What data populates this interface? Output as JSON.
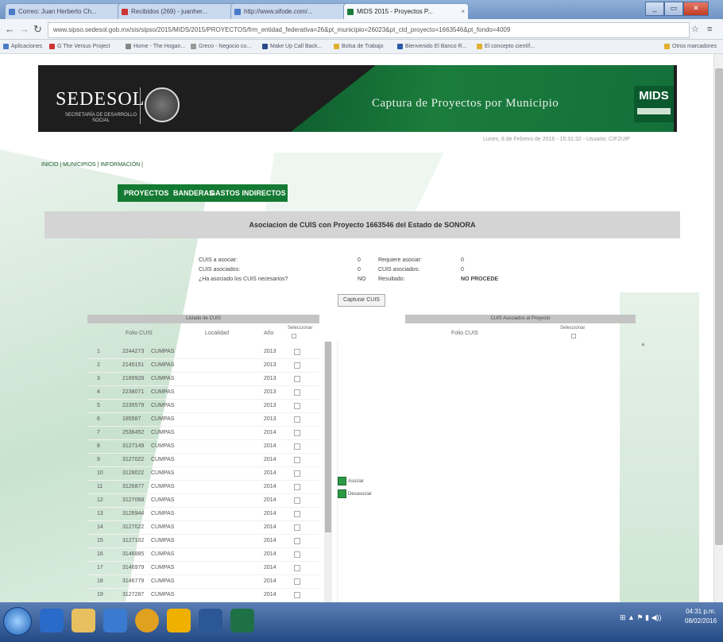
{
  "browser": {
    "tabs": [
      {
        "label": "Correo: Juan Herberto Ch...",
        "active": false
      },
      {
        "label": "Recibidos (269) - juanher...",
        "active": false
      },
      {
        "label": "http://www.sifode.com/...",
        "active": false
      },
      {
        "label": "MIDS 2015 - Proyectos P...",
        "active": true
      }
    ],
    "url": "www.sipso.sedesol.gob.mx/sis/sipso/2015/MIDS/2015/PROYECTOS/frm_entidad_federativa=26&pt_municipio=26023&pt_ctd_proyecto=1663546&pt_fondo=4009",
    "bookmarks": [
      "Aplicaciones",
      "G The Versus Project",
      "Home - The Hogan...",
      "Greco - Negocio co...",
      "Make Up Call Back...",
      "Bolsa de Trabajo",
      "Bienvenido El Banco R...",
      "El concepto científ...",
      "Otros marcadores"
    ],
    "window_buttons": [
      "minimize",
      "maximize",
      "close"
    ]
  },
  "header": {
    "brand": "SEDESOL",
    "brand_sub": "SECRETARÍA DE DESARROLLO SOCIAL",
    "title": "Captura de Proyectos por Municipio",
    "badge": "MIDS",
    "date_user": "Lunes, 8 de Febrero de 2016 - 15:31:32 - Usuario: CIF2UIP"
  },
  "breadcrumb": "INICIO | MUNICIPIOS | INFORMACIÓN |",
  "menu": [
    "PROYECTOS",
    "BANDERAS",
    "GASTOS INDIRECTOS"
  ],
  "page_title": "Asociacion de CUIS con Proyecto 1663546 del Estado de SONORA",
  "summary": {
    "left": [
      {
        "label": "CUIS a asociar:",
        "value": "0"
      },
      {
        "label": "CUIS asociados:",
        "value": "0"
      },
      {
        "label": "¿Ha asociado los CUIS necesarios?",
        "value": "NO"
      }
    ],
    "right": [
      {
        "label": "Requiere asociar:",
        "value": "0"
      },
      {
        "label": "CUIS asociados:",
        "value": "0"
      },
      {
        "label": "Resultado:",
        "value": "NO PROCEDE"
      }
    ],
    "capture_button": "Capturar CUIS"
  },
  "left_panel": {
    "header": "Listado de CUIS",
    "columns": [
      "Folio CUIS",
      "Localidad",
      "Año",
      "Seleccionar"
    ],
    "rows": [
      {
        "n": "1",
        "folio": "2244273",
        "loc": "CUMPAS",
        "year": "2013"
      },
      {
        "n": "2",
        "folio": "2145151",
        "loc": "CUMPAS",
        "year": "2013"
      },
      {
        "n": "3",
        "folio": "2189928",
        "loc": "CUMPAS",
        "year": "2013"
      },
      {
        "n": "4",
        "folio": "2238071",
        "loc": "CUMPAS",
        "year": "2013"
      },
      {
        "n": "5",
        "folio": "2235579",
        "loc": "CUMPAS",
        "year": "2013"
      },
      {
        "n": "6",
        "folio": "185587",
        "loc": "CUMPAS",
        "year": "2013"
      },
      {
        "n": "7",
        "folio": "2536452",
        "loc": "CUMPAS",
        "year": "2014"
      },
      {
        "n": "8",
        "folio": "3127149",
        "loc": "CUMPAS",
        "year": "2014"
      },
      {
        "n": "9",
        "folio": "3127022",
        "loc": "CUMPAS",
        "year": "2014"
      },
      {
        "n": "10",
        "folio": "3128022",
        "loc": "CUMPAS",
        "year": "2014"
      },
      {
        "n": "11",
        "folio": "3126877",
        "loc": "CUMPAS",
        "year": "2014"
      },
      {
        "n": "12",
        "folio": "3127068",
        "loc": "CUMPAS",
        "year": "2014"
      },
      {
        "n": "13",
        "folio": "3126944",
        "loc": "CUMPAS",
        "year": "2014"
      },
      {
        "n": "14",
        "folio": "3127022",
        "loc": "CUMPAS",
        "year": "2014"
      },
      {
        "n": "15",
        "folio": "3127102",
        "loc": "CUMPAS",
        "year": "2014"
      },
      {
        "n": "16",
        "folio": "3146885",
        "loc": "CUMPAS",
        "year": "2014"
      },
      {
        "n": "17",
        "folio": "3146979",
        "loc": "CUMPAS",
        "year": "2014"
      },
      {
        "n": "18",
        "folio": "3146779",
        "loc": "CUMPAS",
        "year": "2014"
      },
      {
        "n": "19",
        "folio": "3127287",
        "loc": "CUMPAS",
        "year": "2014"
      }
    ]
  },
  "right_panel": {
    "header": "CUIS Asociados al Proyecto",
    "columns": [
      "Folio CUIS",
      "Seleccionar"
    ],
    "actions": [
      "Asociar",
      "Desasociar"
    ]
  },
  "taskbar": {
    "time": "04:31 p.m.",
    "date": "08/02/2016"
  },
  "colors": {
    "brand_green": "#147a33",
    "header_dark": "#1e1e1e"
  }
}
